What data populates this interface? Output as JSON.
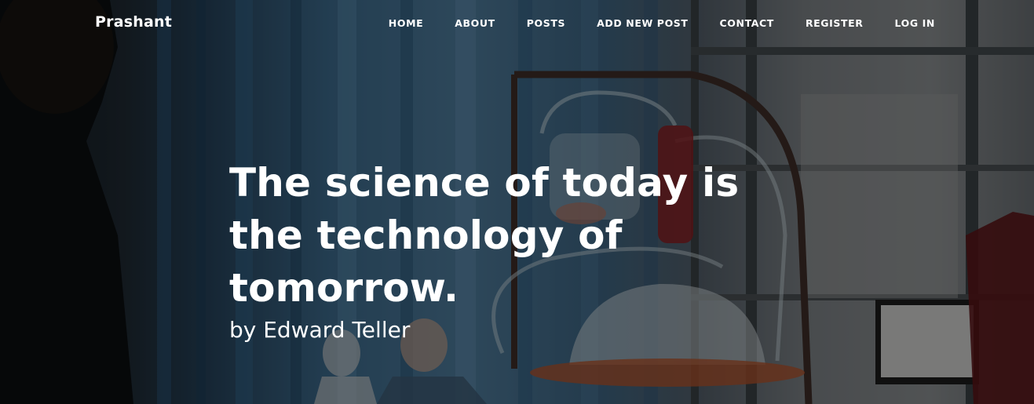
{
  "navbar": {
    "brand": "Prashant",
    "items": [
      {
        "label": "HOME"
      },
      {
        "label": "ABOUT"
      },
      {
        "label": "POSTS"
      },
      {
        "label": "ADD NEW POST"
      },
      {
        "label": "CONTACT"
      },
      {
        "label": "REGISTER"
      },
      {
        "label": "LOG IN"
      }
    ]
  },
  "hero": {
    "quote": "The science of today is the technology of tomorrow.",
    "author": "by Edward Teller"
  },
  "colors": {
    "text": "#ffffff",
    "overlay": "rgba(0,0,0,0.42)"
  }
}
